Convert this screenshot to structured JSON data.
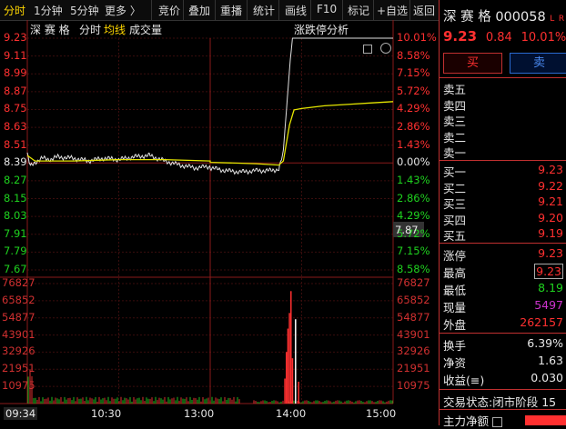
{
  "toolbar": {
    "items": [
      "分时",
      "1分钟",
      "5分钟",
      "更多 〉",
      "竞价",
      "叠加",
      "重播",
      "统计",
      "画线",
      "F10",
      "标记",
      "+自选",
      "返回"
    ]
  },
  "chart_header": {
    "stock_name": "深 赛 格",
    "mode": "分时",
    "avg_line": "均线",
    "volume": "成交量",
    "limit_analysis": "涨跌停分析"
  },
  "price_axis": {
    "left": [
      "9.23",
      "9.11",
      "8.99",
      "8.87",
      "8.75",
      "8.63",
      "8.51",
      "8.39",
      "8.27",
      "8.15",
      "8.03",
      "7.91",
      "7.79",
      "7.67"
    ],
    "right": [
      "10.01%",
      "8.58%",
      "7.15%",
      "5.72%",
      "4.29%",
      "2.86%",
      "1.43%",
      "0.00%",
      "1.43%",
      "2.86%",
      "4.29%",
      "5.72%",
      "7.15%",
      "8.58%"
    ],
    "cursor_price": "7.87"
  },
  "volume_axis": {
    "labels": [
      "76827",
      "65852",
      "54877",
      "43901",
      "32926",
      "21951",
      "10975"
    ]
  },
  "time_axis": {
    "cursor_time": "09:34",
    "labels": [
      "10:30",
      "13:00",
      "14:00",
      "15:00"
    ]
  },
  "chart_data": {
    "type": "line",
    "preclose": 8.39,
    "ylim": [
      7.55,
      9.23
    ],
    "volume_max": 76827,
    "price_series": {
      "name": "分时",
      "x": [
        "09:30",
        "09:32",
        "09:35",
        "09:40",
        "09:45",
        "09:50",
        "10:00",
        "10:10",
        "10:20",
        "10:30",
        "10:40",
        "10:50",
        "11:00",
        "11:10",
        "11:20",
        "11:30",
        "13:00",
        "13:10",
        "13:20",
        "13:30",
        "13:40",
        "13:45",
        "13:48",
        "13:50",
        "13:52",
        "13:54",
        "14:00",
        "14:15",
        "14:30",
        "14:45",
        "15:00"
      ],
      "values": [
        8.39,
        8.3,
        8.33,
        8.36,
        8.35,
        8.37,
        8.36,
        8.34,
        8.36,
        8.35,
        8.37,
        8.38,
        8.34,
        8.31,
        8.29,
        8.3,
        8.29,
        8.27,
        8.26,
        8.27,
        8.27,
        8.28,
        8.4,
        8.7,
        9.0,
        9.23,
        9.23,
        9.23,
        9.23,
        9.23,
        9.23
      ]
    },
    "avg_series": {
      "name": "均线",
      "x": [
        "09:30",
        "09:35",
        "09:45",
        "10:00",
        "10:30",
        "11:00",
        "11:30",
        "13:00",
        "13:30",
        "13:45",
        "13:48",
        "13:52",
        "13:55",
        "14:00",
        "14:15",
        "14:30",
        "14:45",
        "15:00"
      ],
      "values": [
        8.38,
        8.34,
        8.34,
        8.34,
        8.35,
        8.35,
        8.34,
        8.33,
        8.32,
        8.31,
        8.34,
        8.6,
        8.71,
        8.72,
        8.74,
        8.75,
        8.76,
        8.77
      ]
    },
    "volume_peaks": [
      {
        "time": "13:49",
        "value": 16000
      },
      {
        "time": "13:50",
        "value": 33000
      },
      {
        "time": "13:51",
        "value": 48000
      },
      {
        "time": "13:52",
        "value": 58000
      },
      {
        "time": "13:53",
        "value": 72000
      },
      {
        "time": "13:54",
        "value": 29000
      },
      {
        "time": "13:56",
        "value": 54000
      },
      {
        "time": "13:58",
        "value": 14000
      }
    ]
  },
  "quote": {
    "market": "深",
    "name": "赛 格",
    "code": "000058",
    "tag": "L",
    "tag2": "R",
    "price": "9.23",
    "change": "0.84",
    "pct": "10.01%",
    "buy_btn": "买",
    "sell_btn": "卖"
  },
  "order_book": {
    "asks": [
      "卖五",
      "卖四",
      "卖三",
      "卖二",
      "卖一"
    ],
    "bids": [
      {
        "label": "买一",
        "value": "9.23"
      },
      {
        "label": "买二",
        "value": "9.22"
      },
      {
        "label": "买三",
        "value": "9.21"
      },
      {
        "label": "买四",
        "value": "9.20"
      },
      {
        "label": "买五",
        "value": "9.19"
      }
    ]
  },
  "stats": [
    {
      "label": "涨停",
      "value": "9.23",
      "color": "#ff3030"
    },
    {
      "label": "最高",
      "value": "9.23",
      "color": "#ff3030"
    },
    {
      "label": "最低",
      "value": "8.19",
      "color": "#1fd21f"
    },
    {
      "label": "现量",
      "value": "5497",
      "color": "#cc33cc"
    },
    {
      "label": "外盘",
      "value": "262157",
      "color": "#ff3030"
    }
  ],
  "stats2": [
    {
      "label": "换手",
      "value": "6.39%"
    },
    {
      "label": "净资",
      "value": "1.63"
    },
    {
      "label": "收益(≡)",
      "value": "0.030"
    }
  ],
  "trade_status": {
    "label": "交易状态:",
    "value": "闭市阶段 15"
  },
  "main_flow": {
    "label": "主力净额"
  }
}
